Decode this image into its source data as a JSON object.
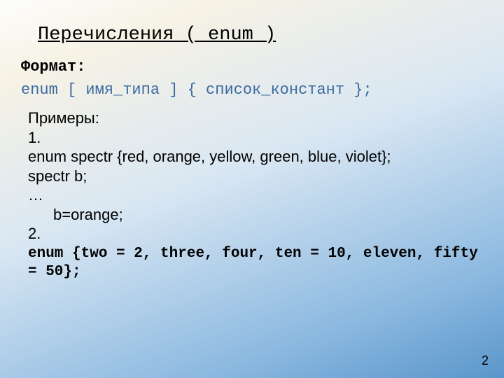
{
  "title": "Перечисления ( enum )",
  "format_label": "Формат:",
  "format_line": "enum [ имя_типа ] { список_констант };",
  "examples": {
    "header": "Примеры:",
    "ex1": {
      "num": "1.",
      "l1": "enum spectr {red, orange, yellow, green, blue, violet};",
      "l2": "spectr b;",
      "l3": "…",
      "l4": "b=orange;"
    },
    "ex2": {
      "num": "2.",
      "code": "enum {two = 2, three, four, ten = 10, eleven, fifty = 50};"
    }
  },
  "page_number": "2"
}
